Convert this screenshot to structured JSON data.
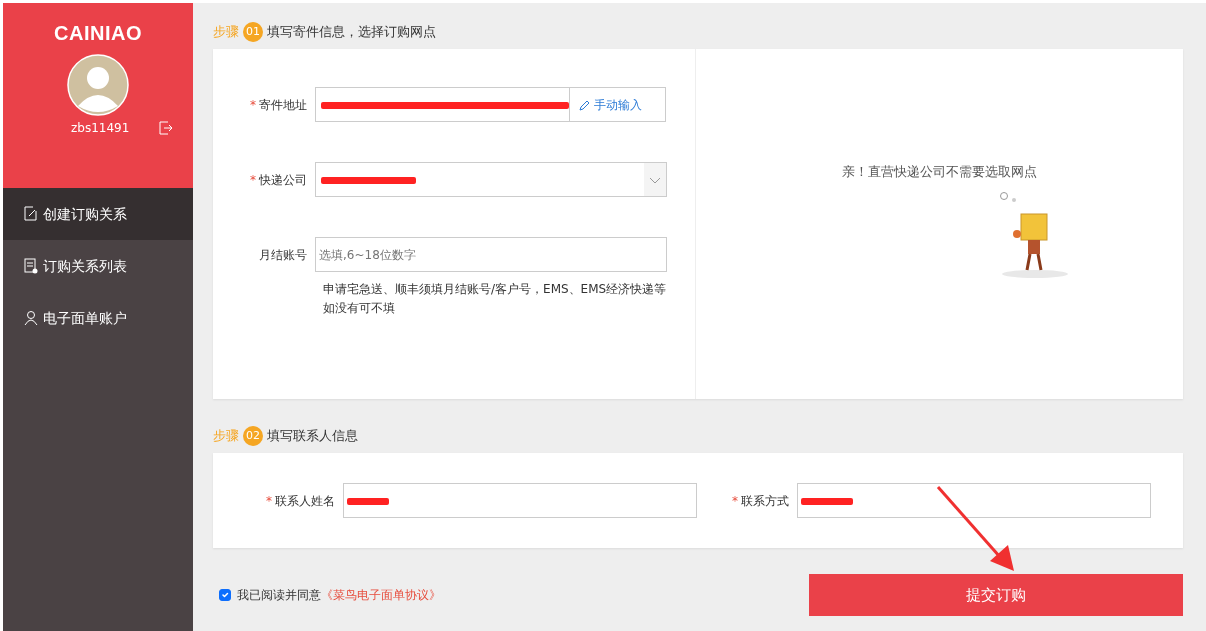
{
  "sidebar": {
    "logo": "CAINIAO",
    "username": "zbs11491",
    "items": [
      {
        "label": "创建订购关系",
        "selected": true
      },
      {
        "label": "订购关系列表",
        "selected": false
      },
      {
        "label": "电子面单账户",
        "selected": false
      }
    ]
  },
  "step1": {
    "prefix": "步骤",
    "number": "01",
    "title": "填写寄件信息，选择订购网点",
    "fields": [
      {
        "kind": "address",
        "label": "寄件地址",
        "mark": "*",
        "button": "手动输入"
      },
      {
        "kind": "select",
        "label": "快递公司",
        "mark": "*"
      },
      {
        "kind": "input",
        "label": "月结账号",
        "placeholder": "选填,6~18位数字",
        "help": "申请宅急送、顺丰须填月结账号/客户号，EMS、EMS经济快递等如没有可不填"
      }
    ],
    "notice": "亲！直营快递公司不需要选取网点"
  },
  "step2": {
    "prefix": "步骤",
    "number": "02",
    "title": "填写联系人信息",
    "fields": [
      {
        "label": "联系人姓名",
        "mark": "*"
      },
      {
        "label": "联系方式",
        "mark": "*"
      }
    ]
  },
  "agreement": {
    "checked": true,
    "text": "我已阅读并同意",
    "link": "《菜鸟电子面单协议》"
  },
  "submit": "提交订购"
}
